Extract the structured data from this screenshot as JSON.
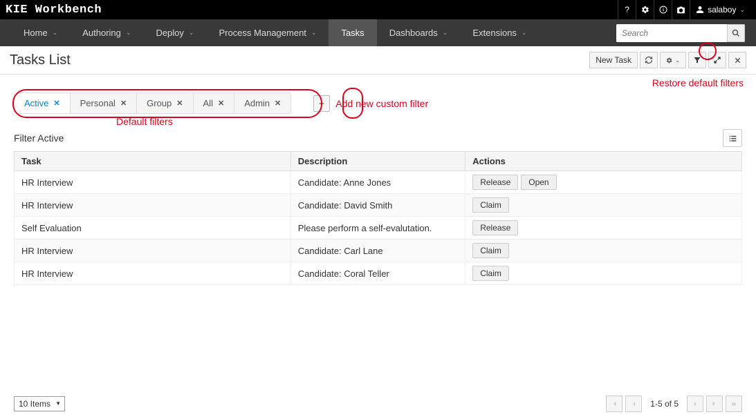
{
  "brand": "KIE Workbench",
  "user": {
    "name": "salaboy"
  },
  "nav": {
    "items": [
      {
        "label": "Home",
        "dropdown": true
      },
      {
        "label": "Authoring",
        "dropdown": true
      },
      {
        "label": "Deploy",
        "dropdown": true
      },
      {
        "label": "Process Management",
        "dropdown": true
      },
      {
        "label": "Tasks",
        "dropdown": false,
        "active": true
      },
      {
        "label": "Dashboards",
        "dropdown": true
      },
      {
        "label": "Extensions",
        "dropdown": true
      }
    ],
    "search_placeholder": "Search"
  },
  "page": {
    "title": "Tasks List",
    "tools": {
      "new_task": "New Task"
    }
  },
  "annotations": {
    "restore": "Restore default filters",
    "default_filters": "Default filters",
    "add_new": "Add new custom filter"
  },
  "filters": {
    "tabs": [
      {
        "label": "Active",
        "active": true
      },
      {
        "label": "Personal"
      },
      {
        "label": "Group"
      },
      {
        "label": "All"
      },
      {
        "label": "Admin"
      }
    ],
    "current_label": "Filter Active"
  },
  "table": {
    "headers": {
      "task": "Task",
      "description": "Description",
      "actions": "Actions"
    },
    "rows": [
      {
        "task": "HR Interview",
        "description": "Candidate: Anne Jones",
        "actions": [
          "Release",
          "Open"
        ]
      },
      {
        "task": "HR Interview",
        "description": "Candidate: David Smith",
        "actions": [
          "Claim"
        ]
      },
      {
        "task": "Self Evaluation",
        "description": "Please perform a self-evalutation.",
        "actions": [
          "Release"
        ]
      },
      {
        "task": "HR Interview",
        "description": "Candidate: Carl Lane",
        "actions": [
          "Claim"
        ]
      },
      {
        "task": "HR Interview",
        "description": "Candidate: Coral Teller",
        "actions": [
          "Claim"
        ]
      }
    ]
  },
  "pagination": {
    "page_size_label": "10 Items",
    "info": "1-5 of 5"
  }
}
